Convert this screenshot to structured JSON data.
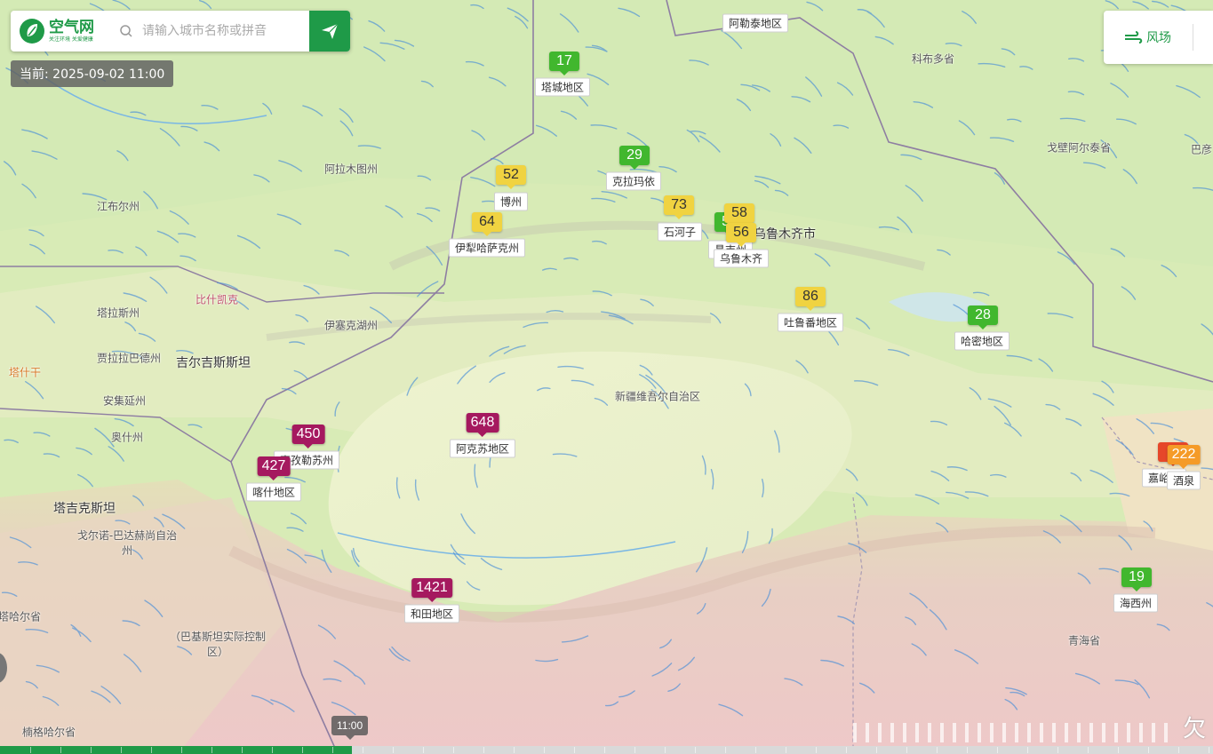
{
  "header": {
    "logo_title": "空气网",
    "logo_subtitle": "关注环境 关爱健康",
    "search_placeholder": "请输入城市名称或拼音",
    "current_time": "当前: 2025-09-02 11:00"
  },
  "wind_toggle": {
    "label": "风场"
  },
  "timeline": {
    "pointer_label": "11:00",
    "progress": 0.29
  },
  "colors": {
    "brand": "#1f9a48",
    "aqi_good": "#41b72e",
    "aqi_moderate": "#f0d341",
    "aqi_unhealthy_sensitive": "#f59b28",
    "aqi_unhealthy": "#e6472a",
    "aqi_hazardous": "#a5195f"
  },
  "places": [
    {
      "name": "阿勒泰地区",
      "type": "label"
    },
    {
      "name": "科布多省",
      "type": "plain"
    },
    {
      "name": "戈壁阿尔泰省",
      "type": "plain"
    },
    {
      "name": "巴彦",
      "type": "plain"
    },
    {
      "name": "阿拉木图州",
      "type": "plain"
    },
    {
      "name": "江布尔州",
      "type": "plain"
    },
    {
      "name": "比什凯克",
      "type": "pink"
    },
    {
      "name": "塔拉斯州",
      "type": "plain"
    },
    {
      "name": "伊塞克湖州",
      "type": "plain"
    },
    {
      "name": "贾拉拉巴德州",
      "type": "plain"
    },
    {
      "name": "吉尔吉斯斯坦",
      "type": "big"
    },
    {
      "name": "塔什干",
      "type": "orange"
    },
    {
      "name": "安集延州",
      "type": "plain"
    },
    {
      "name": "奥什州",
      "type": "plain"
    },
    {
      "name": "塔吉克斯坦",
      "type": "big"
    },
    {
      "name": "戈尔诺-巴达赫尚自治州",
      "type": "plain"
    },
    {
      "name": "（巴基斯坦实际控制区）",
      "type": "plain"
    },
    {
      "name": "新疆维吾尔自治区",
      "type": "plain"
    },
    {
      "name": "乌鲁木齐市",
      "type": "big"
    },
    {
      "name": "青海省",
      "type": "plain"
    },
    {
      "name": "楠格哈尔省",
      "type": "plain"
    },
    {
      "name": "塔哈尔省",
      "type": "plain"
    }
  ],
  "stations": [
    {
      "name": "塔城地区",
      "aqi": "17",
      "level": "good"
    },
    {
      "name": "克拉玛依",
      "aqi": "29",
      "level": "good"
    },
    {
      "name": "博州",
      "aqi": "52",
      "level": "moderate"
    },
    {
      "name": "伊犁哈萨克州",
      "aqi": "64",
      "level": "moderate"
    },
    {
      "name": "石河子",
      "aqi": "73",
      "level": "moderate"
    },
    {
      "name": "昌吉州",
      "aqi": "50",
      "level": "good"
    },
    {
      "name": "五家渠",
      "aqi": "58",
      "level": "moderate"
    },
    {
      "name": "乌鲁木齐",
      "aqi": "56",
      "level": "moderate"
    },
    {
      "name": "吐鲁番地区",
      "aqi": "86",
      "level": "moderate"
    },
    {
      "name": "哈密地区",
      "aqi": "28",
      "level": "good"
    },
    {
      "name": "阿克苏地区",
      "aqi": "648",
      "level": "hazardous"
    },
    {
      "name": "克孜勒苏州",
      "aqi": "450",
      "level": "hazardous"
    },
    {
      "name": "喀什地区",
      "aqi": "427",
      "level": "hazardous"
    },
    {
      "name": "和田地区",
      "aqi": "1421",
      "level": "hazardous"
    },
    {
      "name": "嘉峪关",
      "aqi": "2",
      "level": "unhealthy"
    },
    {
      "name": "酒泉",
      "aqi": "222",
      "level": "unhealthy_sensitive"
    },
    {
      "name": "海西州",
      "aqi": "19",
      "level": "good"
    }
  ]
}
